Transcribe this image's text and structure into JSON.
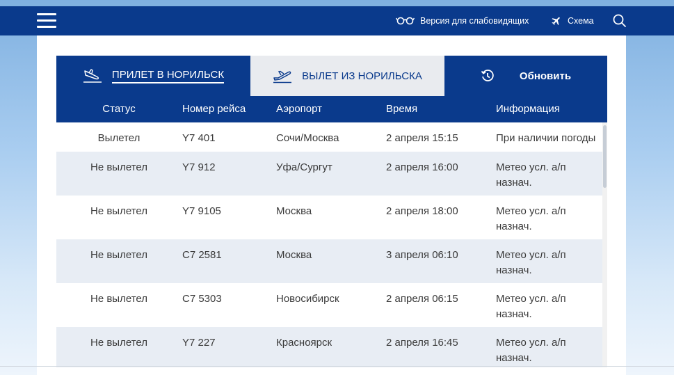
{
  "header": {
    "accessibility_label": "Версия для слабовидящих",
    "scheme_label": "Схема"
  },
  "tabs": {
    "arrivals": "ПРИЛЕТ В НОРИЛЬСК",
    "departures": "ВЫЛЕТ ИЗ НОРИЛЬСКА",
    "refresh": "Обновить"
  },
  "columns": {
    "status": "Статус",
    "flight": "Номер рейса",
    "airport": "Аэропорт",
    "time": "Время",
    "info": "Информация"
  },
  "rows": [
    {
      "status": "Вылетел",
      "flight": "Y7 401",
      "airport": "Сочи/Москва",
      "time": "2 апреля 15:15",
      "info": "При наличии погоды"
    },
    {
      "status": "Не вылетел",
      "flight": "Y7 912",
      "airport": "Уфа/Сургут",
      "time": "2 апреля 16:00",
      "info": "Метео усл. а/п назнач."
    },
    {
      "status": "Не вылетел",
      "flight": "Y7 9105",
      "airport": "Москва",
      "time": "2 апреля 18:00",
      "info": "Метео усл. а/п назнач."
    },
    {
      "status": "Не вылетел",
      "flight": "С7 2581",
      "airport": "Москва",
      "time": "3 апреля 06:10",
      "info": "Метео усл. а/п назнач."
    },
    {
      "status": "Не вылетел",
      "flight": "С7 5303",
      "airport": "Новосибирск",
      "time": "2 апреля 06:15",
      "info": "Метео усл. а/п назнач."
    },
    {
      "status": "Не вылетел",
      "flight": "Y7 227",
      "airport": "Красноярск",
      "time": "2 апреля 16:45",
      "info": "Метео усл. а/п назнач."
    }
  ],
  "colors": {
    "brand": "#0a3a8c",
    "row_alt": "#e8edf4"
  }
}
